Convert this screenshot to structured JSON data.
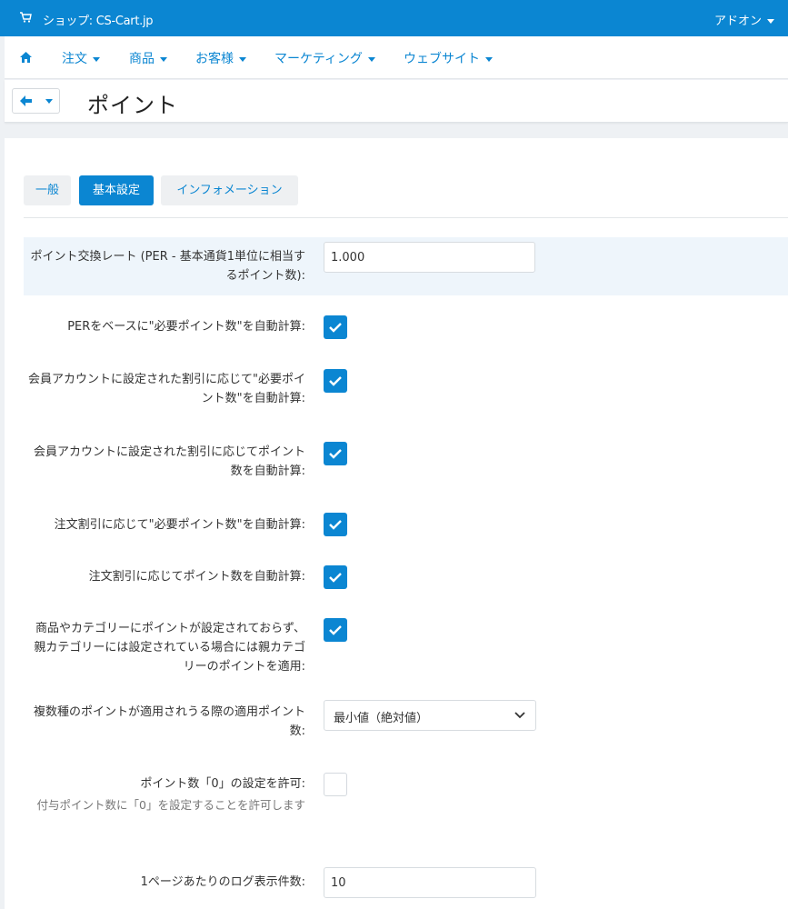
{
  "topbar": {
    "store_label": "ショップ: CS-Cart.jp",
    "addons_label": "アドオン"
  },
  "nav": {
    "items": [
      {
        "label": "注文"
      },
      {
        "label": "商品"
      },
      {
        "label": "お客様"
      },
      {
        "label": "マーケティング"
      },
      {
        "label": "ウェブサイト"
      }
    ]
  },
  "page": {
    "title": "ポイント"
  },
  "tabs": [
    {
      "label": "一般",
      "active": false
    },
    {
      "label": "基本設定",
      "active": true
    },
    {
      "label": "インフォメーション",
      "active": false
    }
  ],
  "settings": {
    "exchange_rate": {
      "label": "ポイント交換レート (PER - 基本通貨1単位に相当するポイント数):",
      "value": "1.000"
    },
    "auto_calc_price_points": {
      "label": "PERをベースに\"必要ポイント数\"を自動計算:",
      "checked": true
    },
    "auto_calc_user_discount_price": {
      "label": "会員アカウントに設定された割引に応じて\"必要ポイント数\"を自動計算:",
      "checked": true
    },
    "auto_calc_user_discount_points": {
      "label": "会員アカウントに設定された割引に応じてポイント数を自動計算:",
      "checked": true
    },
    "auto_calc_order_discount_price": {
      "label": "注文割引に応じて\"必要ポイント数\"を自動計算:",
      "checked": true
    },
    "auto_calc_order_discount_points": {
      "label": "注文割引に応じてポイント数を自動計算:",
      "checked": true
    },
    "apply_parent_category_points": {
      "label": "商品やカテゴリーにポイントが設定されておらず、親カテゴリーには設定されている場合には親カテゴリーのポイントを適用:",
      "checked": true
    },
    "multiple_points_mode": {
      "label": "複数種のポイントが適用されうる際の適用ポイント数:",
      "selected": "最小値（絶対値）"
    },
    "allow_zero_points": {
      "label": "ポイント数「0」の設定を許可:",
      "hint": "付与ポイント数に「0」を設定することを許可します",
      "checked": false
    },
    "log_per_page": {
      "label": "1ページあたりのログ表示件数:",
      "value": "10"
    }
  },
  "colors": {
    "accent": "#0b86d2",
    "highlight_row": "#eef5fb"
  }
}
